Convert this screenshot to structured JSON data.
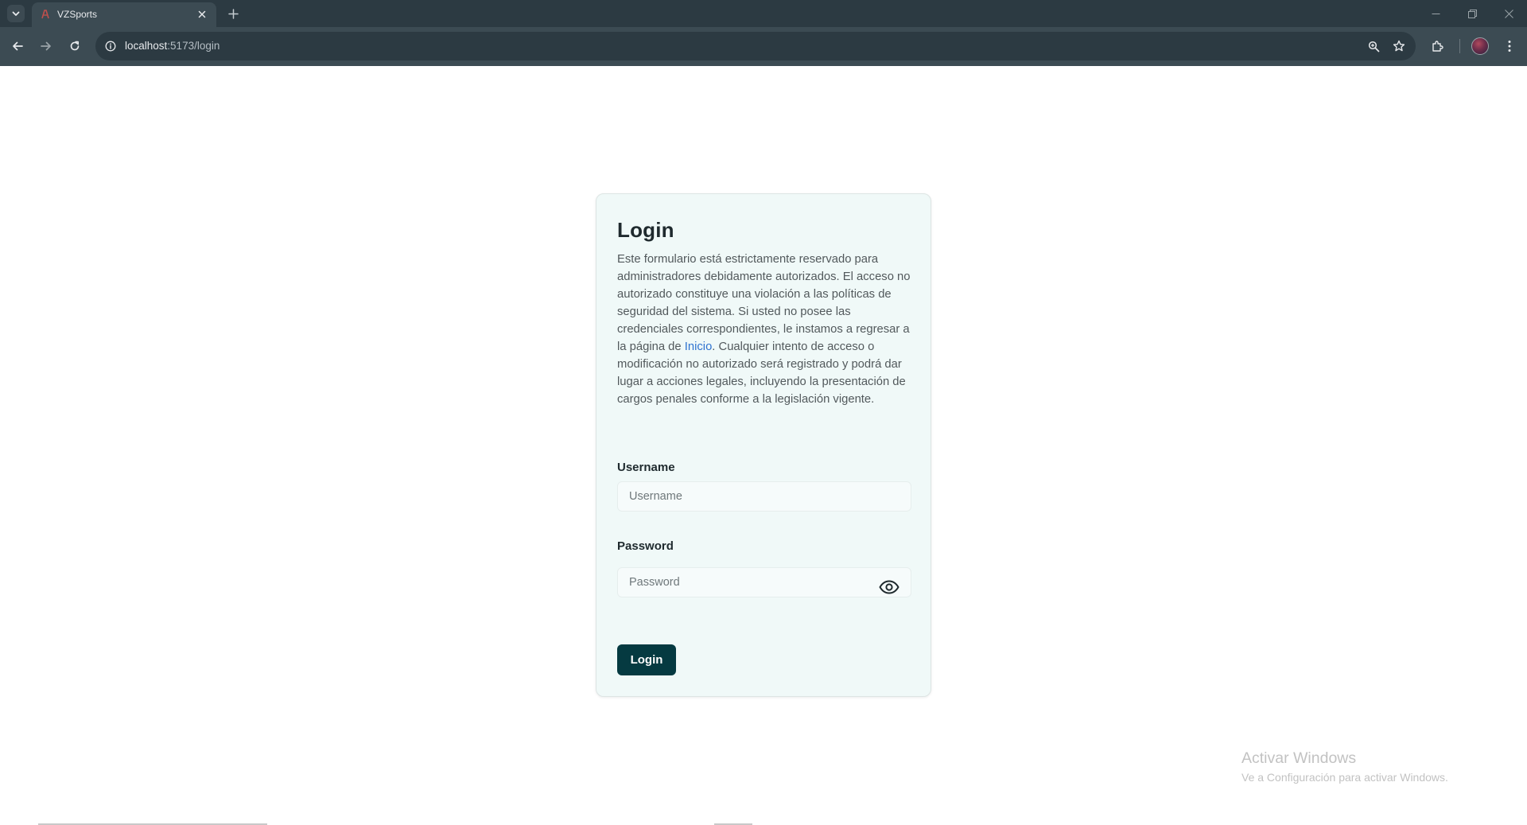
{
  "browser": {
    "tab": {
      "title": "VZSports"
    },
    "url": {
      "host": "localhost",
      "path": ":5173/login"
    }
  },
  "login": {
    "title": "Login",
    "description_before": "Este formulario está estrictamente reservado para administradores debidamente autorizados. El acceso no autorizado constituye una violación a las políticas de seguridad del sistema. Si usted no posee las credenciales correspondientes, le instamos a regresar a la página de ",
    "description_link": "Inicio",
    "description_after": ". Cualquier intento de acceso o modificación no autorizado será registrado y podrá dar lugar a acciones legales, incluyendo la presentación de cargos penales conforme a la legislación vigente.",
    "username_label": "Username",
    "username_placeholder": "Username",
    "username_value": "",
    "password_label": "Password",
    "password_placeholder": "Password",
    "password_value": "",
    "submit_label": "Login"
  },
  "watermark": {
    "title": "Activar Windows",
    "subtitle": "Ve a Configuración para activar Windows."
  },
  "icons": {
    "tab_search": "chevron-down-icon",
    "favicon": "vzsports-favicon",
    "tab_close": "close-icon",
    "new_tab": "plus-icon",
    "back": "arrow-left-icon",
    "forward": "arrow-right-icon",
    "reload": "reload-icon",
    "site_info": "info-icon",
    "zoom": "zoom-icon",
    "bookmark": "star-icon",
    "extensions": "puzzle-icon",
    "menu": "kebab-menu-icon",
    "password_toggle": "eye-icon"
  },
  "colors": {
    "chrome_dark": "#2c3a42",
    "chrome_toolbar": "#3c4b53",
    "card_bg": "#f0f9f8",
    "button_bg": "#053a41",
    "link": "#2f73d0"
  }
}
